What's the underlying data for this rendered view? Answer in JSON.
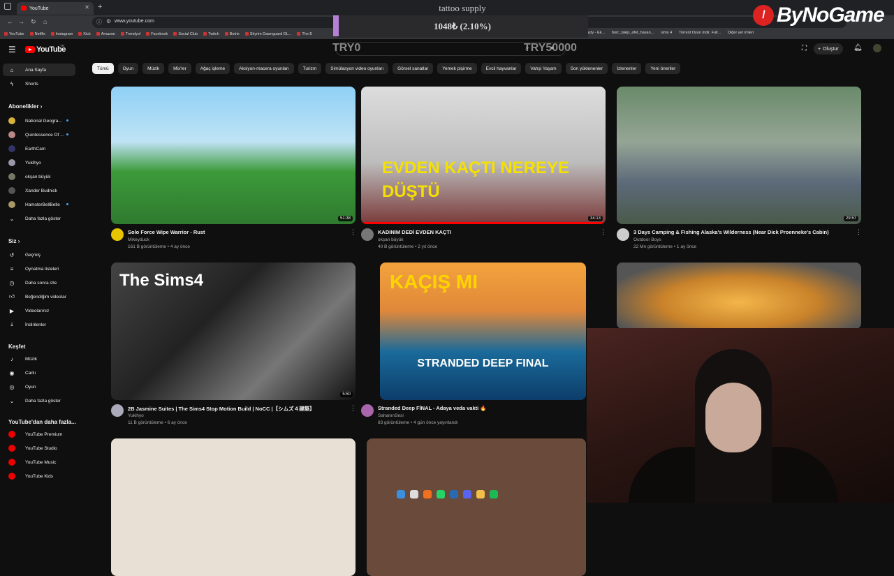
{
  "browser": {
    "tab_title": "YouTube",
    "url": "www.youtube.com",
    "bookmarks": [
      "YouTube",
      "Netflix",
      "Instagram",
      "Kick",
      "Amazon",
      "Trendyol",
      "Facebook",
      "Social Club",
      "Twitch",
      "Botrix",
      "Skyrim Dawnguard DL...",
      "The E"
    ],
    "bookmarks_right": [
      "asty - Ek...",
      "borc_takip_afet_hasan...",
      "sims 4",
      "Torrent Oyun indir, Full...",
      "Diğer yer imleri"
    ]
  },
  "overlay": {
    "donation_title": "tattoo supply",
    "donation_amount": "1048₺ (2.10%)",
    "donation_min": "TRY0",
    "donation_max": "TRY50000",
    "brand": "ByNoGame"
  },
  "header": {
    "logo": "YouTube",
    "country": "TR",
    "create_label": "Oluştur",
    "icons": [
      "menu-icon",
      "search-icon",
      "mic-icon",
      "create-icon",
      "bell-icon"
    ]
  },
  "chips": [
    "Tümü",
    "Oyun",
    "Müzik",
    "Mix'ler",
    "Ağaç işleme",
    "Aksiyon-macera oyunları",
    "Turizm",
    "Simülasyon video oyunları",
    "Görsel sanatlar",
    "Yemek pişirme",
    "Evcil hayvanlar",
    "Vahşi Yaşam",
    "Son yüklenenler",
    "İzlenenler",
    "Yeni öneriler"
  ],
  "sidebar": {
    "home": "Ana Sayfa",
    "shorts": "Shorts",
    "subs_head": "Abonelikler",
    "subs": [
      "National Geogra...",
      "Quintessence Of ...",
      "EarthCam",
      "Yukihyo",
      "okşan büyük",
      "Xander Budnick",
      "HamsterBellBelle"
    ],
    "show_more": "Daha fazla göster",
    "you_head": "Siz",
    "you": [
      "Geçmiş",
      "Oynatma listeleri",
      "Daha sonra izle",
      "Beğendiğim videolar",
      "Videolarınız",
      "İndirilenler"
    ],
    "explore_head": "Keşfet",
    "explore": [
      "Müzik",
      "Canlı",
      "Oyun"
    ],
    "explore_more": "Daha fazla göster",
    "more_head": "YouTube'dan daha fazla...",
    "more": [
      "YouTube Premium",
      "YouTube Studio",
      "YouTube Music",
      "YouTube Kids"
    ]
  },
  "videos": [
    {
      "title": "Solo Force Wipe Warrior - Rust",
      "channel": "Mikeyduck",
      "meta": "161 B görüntüleme • 4 ay önce",
      "duration": "51:38"
    },
    {
      "title": "KADINIM DEDİ EVDEN KAÇTI",
      "channel": "okşan büyük",
      "meta": "40 B görüntüleme • 2 yıl önce",
      "duration": "34:13",
      "thumb_text": "EVDEN KAÇTI NEREYE DÜŞTÜ"
    },
    {
      "title": "3 Days Camping & Fishing Alaska's Wilderness (Near Dick Proenneke's Cabin)",
      "channel": "Outdoor Boys",
      "meta": "22 Mn görüntüleme • 1 ay önce",
      "duration": "29:57"
    },
    {
      "title": "2B Jasmine Suites | The Sims4 Stop Motion Build | NoCC |【シムズ４建築】",
      "channel": "Yukihyo",
      "meta": "11 B görüntüleme • 6 ay önce",
      "duration": "5:50",
      "thumb_text": "The Sims4"
    },
    {
      "title": "Stranded Deep FİNAL - Adaya veda vakti 🔥",
      "channel": "SahanınSesi",
      "meta": "83 görüntüleme • 4 gün önce yayınlandı",
      "duration": "",
      "thumb_text": "KAÇIŞ MI",
      "thumb_text2": "STRANDED DEEP FINAL"
    }
  ]
}
